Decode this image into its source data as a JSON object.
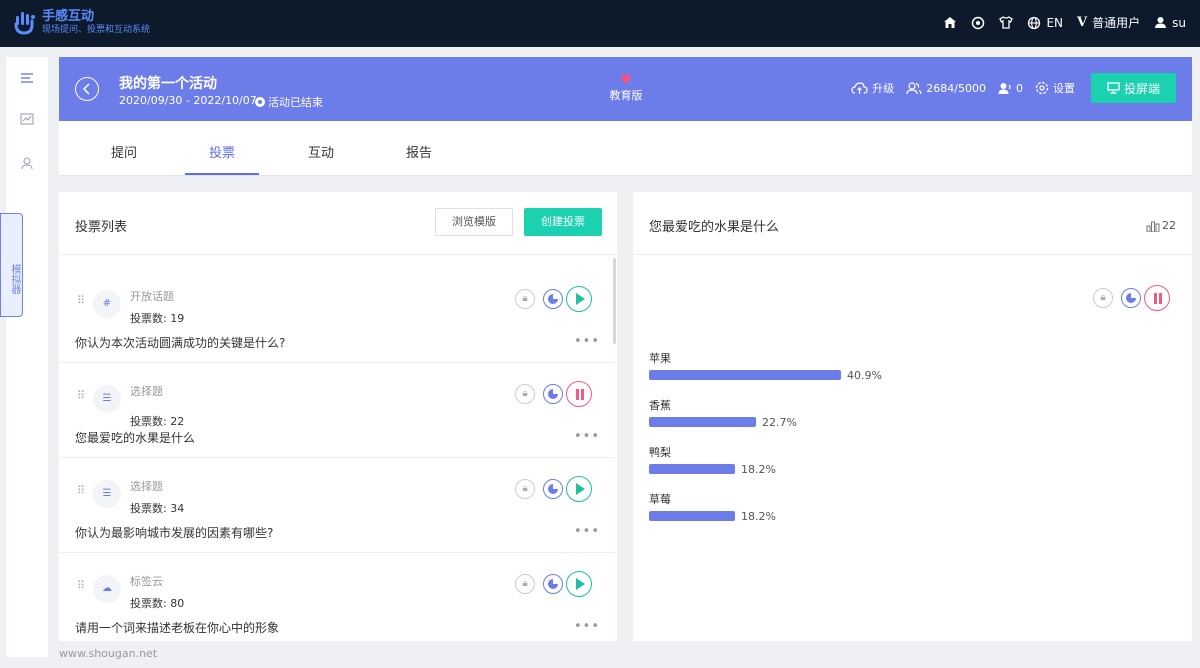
{
  "app": {
    "title": "手感互动",
    "subtitle": "现场提问、投票和互动系统"
  },
  "topnav": {
    "lang": "EN",
    "user_type": "普通用户",
    "user_name": "su"
  },
  "activity": {
    "title": "我的第一个活动",
    "dates": "2020/09/30 - 2022/10/07",
    "status": "活动已结束",
    "edition": "教育版",
    "upgrade": "升级",
    "participants": "2684/5000",
    "online": "0",
    "settings": "设置",
    "screen_button": "投屏端"
  },
  "side_tab": "模拟器",
  "tabs": [
    {
      "label": "提问"
    },
    {
      "label": "投票"
    },
    {
      "label": "互动"
    },
    {
      "label": "报告"
    }
  ],
  "vote_list": {
    "title": "投票列表",
    "browse_template": "浏览模版",
    "create_vote": "创建投票",
    "items": [
      {
        "type_icon": "hashtag-icon",
        "type": "开放话题",
        "count": "投票数: 19",
        "question": "你认为本次活动圆满成功的关键是什么?",
        "state": "play"
      },
      {
        "type_icon": "checklist-icon",
        "type": "选择题",
        "count": "投票数: 22",
        "question": "您最爱吃的水果是什么",
        "state": "pause"
      },
      {
        "type_icon": "checklist-icon",
        "type": "选择题",
        "count": "投票数: 34",
        "question": "你认为最影响城市发展的因素有哪些?",
        "state": "play"
      },
      {
        "type_icon": "cloud-icon",
        "type": "标签云",
        "count": "投票数: 80",
        "question": "请用一个词来描述老板在你心中的形象",
        "state": "play"
      }
    ]
  },
  "result": {
    "question": "您最爱吃的水果是什么",
    "total": "22",
    "options": [
      {
        "label": "苹果",
        "percent": 40.9,
        "text": "40.9%"
      },
      {
        "label": "香蕉",
        "percent": 22.7,
        "text": "22.7%"
      },
      {
        "label": "鸭梨",
        "percent": 18.2,
        "text": "18.2%"
      },
      {
        "label": "草莓",
        "percent": 18.2,
        "text": "18.2%"
      }
    ]
  },
  "footer": "www.shougan.net"
}
